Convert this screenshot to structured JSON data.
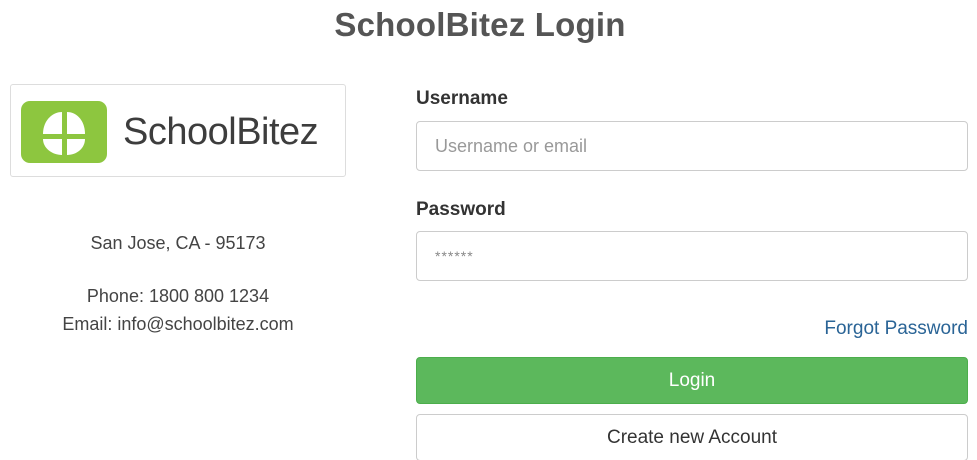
{
  "page": {
    "title": "SchoolBitez Login"
  },
  "brand": {
    "name": "SchoolBitez",
    "accent_color": "#8dc63f"
  },
  "contact": {
    "address": "San Jose, CA - 95173",
    "phone": "Phone: 1800 800 1234",
    "email": "Email: info@schoolbitez.com"
  },
  "form": {
    "username_label": "Username",
    "username_placeholder": "Username or email",
    "username_value": "",
    "password_label": "Password",
    "password_placeholder": "******",
    "password_value": "",
    "forgot_label": "Forgot Password",
    "login_label": "Login",
    "create_label": "Create new Account"
  },
  "colors": {
    "login_button": "#5cb85c",
    "link": "#2a6496"
  }
}
